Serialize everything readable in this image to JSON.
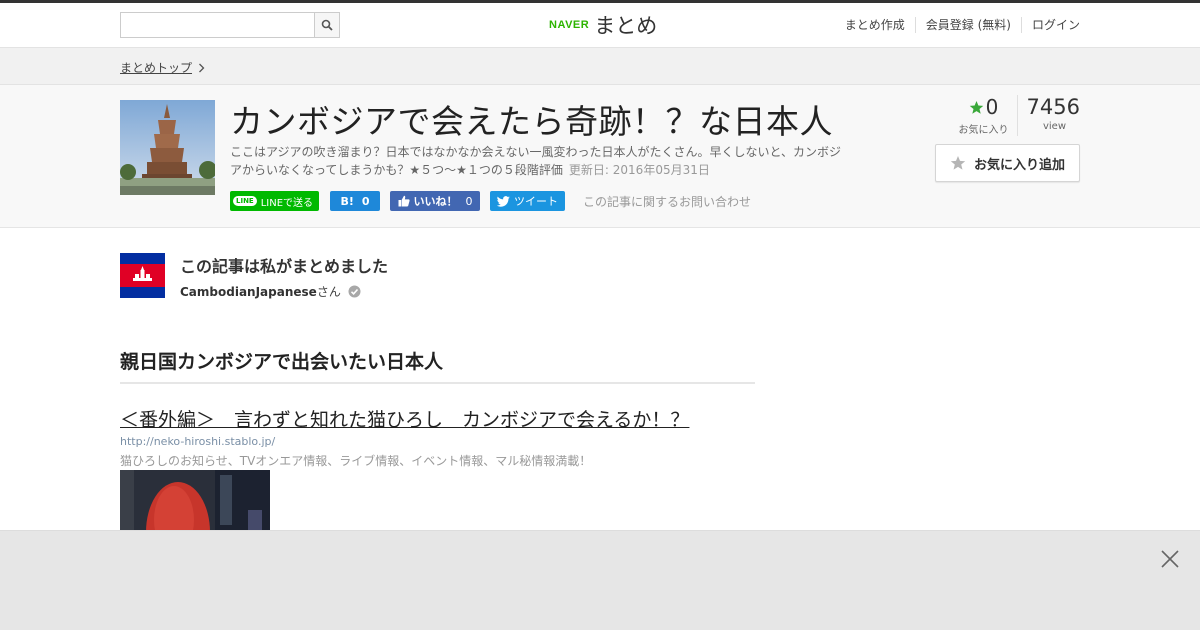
{
  "header": {
    "search_value": "",
    "search_icon": "search-icon",
    "logo_naver": "NAVER",
    "logo_matome": "まとめ",
    "nav": [
      "まとめ作成",
      "会員登録 (無料)",
      "ログイン"
    ]
  },
  "breadcrumb": {
    "label": "まとめトップ"
  },
  "article": {
    "title": "カンボジアで会えたら奇跡！？な日本人",
    "description": "ここはアジアの吹き溜まり？日本ではなかなか会えない一風変わった日本人がたくさん。早くしないと、カンボジアからいなくなってしまうかも？★５つ〜★１つの５段階評価",
    "updated": "更新日: 2016年05月31日",
    "share": {
      "line_icon": "LINE",
      "line_label": "LINEで送る",
      "hatena_label": "B!",
      "hatena_count": "0",
      "fb_label": "いいね！",
      "fb_count": "0",
      "tweet_label": "ツイート"
    },
    "inquiry": "この記事に関するお問い合わせ",
    "favorites": "0",
    "favorites_label": "お気に入り",
    "views": "7456",
    "views_label": "view",
    "fav_button": "お気に入り追加"
  },
  "author": {
    "heading": "この記事は私がまとめました",
    "name": "CambodianJapanese",
    "suffix": "さん"
  },
  "content": {
    "section_heading": "親日国カンボジアで出会いたい日本人",
    "link_title": "＜番外編＞　言わずと知れた猫ひろし　カンボジアで会えるか！？",
    "link_url": "http://neko-hiroshi.stablo.jp/",
    "link_desc": "猫ひろしのお知らせ、TVオンエア情報、ライブ情報、イベント情報、マル秘情報満載！"
  },
  "colors": {
    "naver_green": "#2db400",
    "line_green": "#00b900",
    "hatena_blue": "#1e88d9",
    "facebook_blue": "#4267b2",
    "twitter_blue": "#1b95e0",
    "star_green": "#3aa83a"
  }
}
